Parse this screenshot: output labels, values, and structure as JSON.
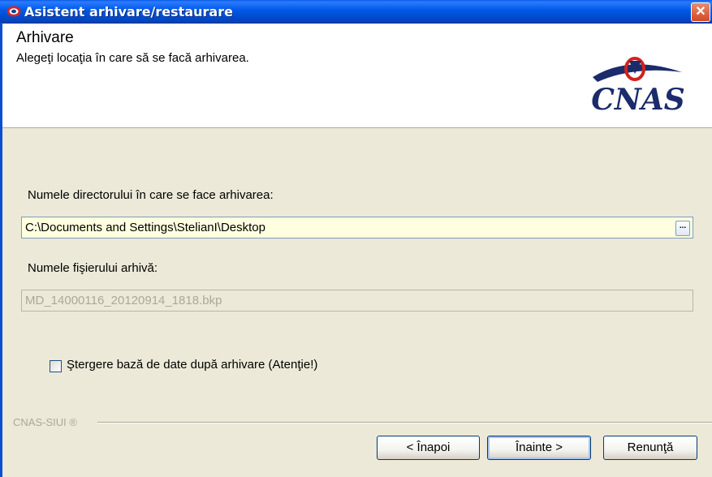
{
  "window": {
    "title": "Asistent arhivare/restaurare",
    "close_glyph": "✕"
  },
  "header": {
    "title": "Arhivare",
    "subtitle": "Alegeţi locaţia în care să se facă arhivarea.",
    "logo_text": "CNAS"
  },
  "form": {
    "dir_label": "Numele directorului în care se face arhivarea:",
    "dir_value": "C:\\Documents and Settings\\StelianI\\Desktop",
    "browse_label": "...",
    "file_label": "Numele fişierului arhivă:",
    "file_value": "MD_14000116_20120914_1818.bkp",
    "delete_checkbox_label": "Ştergere bază de date după arhivare (Atenţie!)",
    "delete_checked": false
  },
  "footer": {
    "brand": "CNAS-SIUI ®",
    "back_label": "< Înapoi",
    "next_label": "Înainte >",
    "cancel_label": "Renunţă"
  },
  "colors": {
    "titlebar": "#0058e6",
    "dir_input_bg": "#ffffe0",
    "dialog_bg": "#ece9d8"
  }
}
